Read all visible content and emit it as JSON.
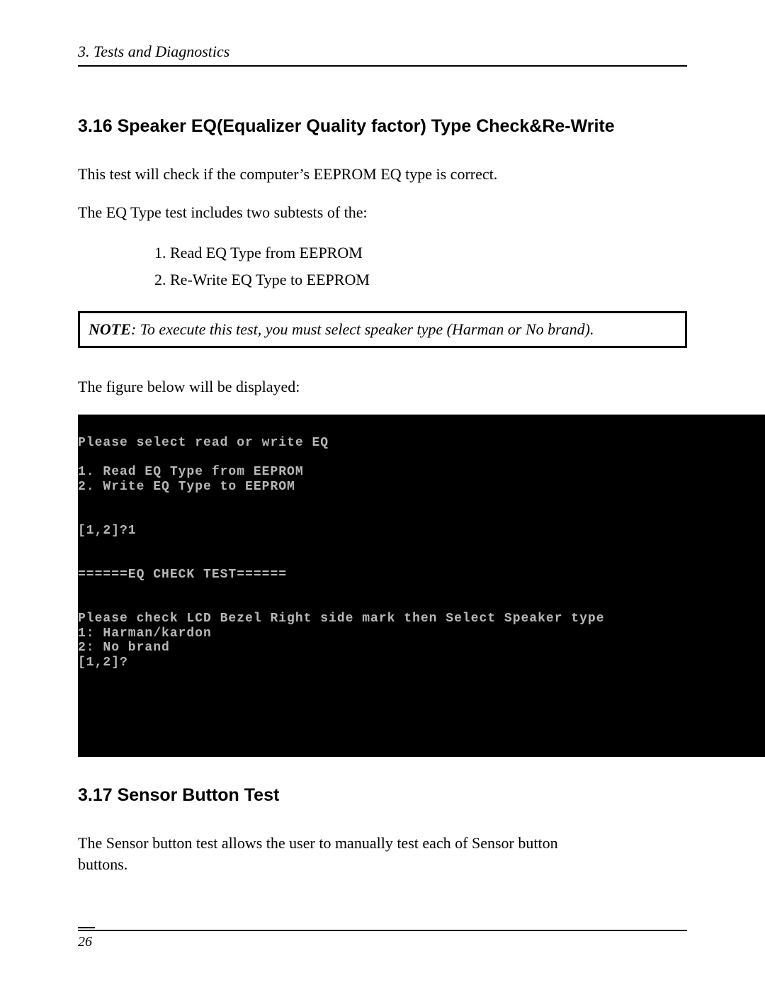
{
  "header": {
    "running_head": "3.  Tests and Diagnostics"
  },
  "section316": {
    "heading": "3.16 Speaker EQ(Equalizer Quality factor) Type Check&Re-Write",
    "intro": "This test will check if the computer’s EEPROM EQ type is correct.",
    "subtests_intro": "The EQ Type test includes two subtests of the:",
    "subtests": [
      "Read EQ Type from EEPROM",
      "Re-Write EQ Type to EEPROM"
    ],
    "note_label": "NOTE",
    "note_text": ":  To execute this test, you must select speaker type (Harman or No brand).",
    "figure_intro": "The figure below will be displayed:"
  },
  "terminal": {
    "lines": [
      "Please select read or write EQ",
      "",
      "1. Read EQ Type from EEPROM",
      "2. Write EQ Type to EEPROM",
      "",
      "",
      "[1,2]?1",
      "",
      "",
      "======EQ CHECK TEST======",
      "",
      "",
      "Please check LCD Bezel Right side mark then Select Speaker type",
      "1: Harman/kardon",
      "2: No brand",
      "[1,2]?",
      "",
      "",
      "",
      ""
    ]
  },
  "section317": {
    "heading": "3.17 Sensor Button Test",
    "body": "The Sensor button test allows the user to manually test each of Sensor button buttons."
  },
  "footer": {
    "page_number": "26"
  }
}
